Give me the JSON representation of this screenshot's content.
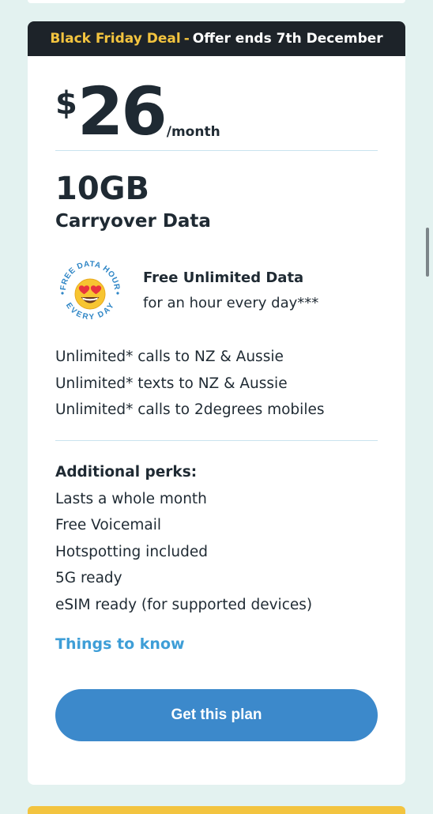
{
  "banner": {
    "deal": "Black Friday Deal",
    "separator": "-",
    "offer": "Offer ends 7th December"
  },
  "price": {
    "currency": "$",
    "amount": "26",
    "period": "/month"
  },
  "data": {
    "amount": "10GB",
    "label": "Carryover Data"
  },
  "badge": {
    "top_text": "FREE DATA HOUR",
    "bottom_text": "EVERY DAY",
    "icon": "heart-eyes-emoji-icon"
  },
  "free_data": {
    "title": "Free Unlimited Data",
    "subtitle": "for an hour every day***"
  },
  "features": [
    "Unlimited* calls to NZ & Aussie",
    "Unlimited* texts to NZ & Aussie",
    "Unlimited* calls to 2degrees mobiles"
  ],
  "perks": {
    "heading": "Additional perks:",
    "items": [
      "Lasts a whole month",
      "Free Voicemail",
      "Hotspotting included",
      "5G ready",
      "eSIM ready (for supported devices)"
    ]
  },
  "things_to_know": "Things to know",
  "cta": "Get this plan",
  "colors": {
    "page_bg": "#e3f2f0",
    "banner_bg": "#1d2329",
    "deal_yellow": "#f3c43f",
    "link_blue": "#3e9ed7",
    "button_blue": "#3c89cb"
  }
}
